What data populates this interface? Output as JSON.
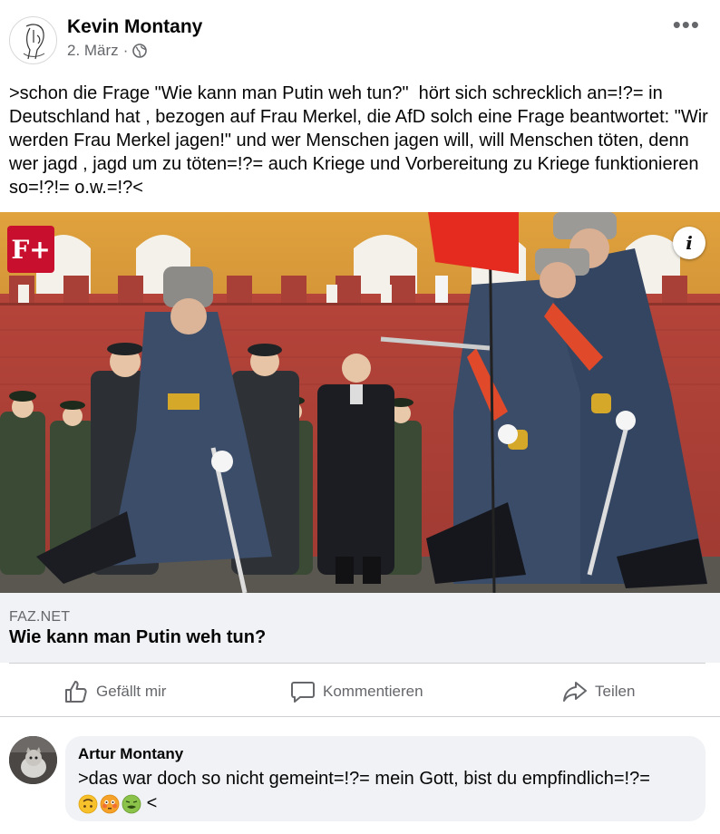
{
  "post": {
    "author": "Kevin Montany",
    "date": "2. März",
    "separator": "·",
    "more_label": "•••",
    "text": ">schon die Frage \"Wie kann man Putin weh tun?\"  hört sich schrecklich an=!?= in Deutschland hat , bezogen auf Frau Merkel, die AfD solch eine Frage beantwortet: \"Wir werden Frau Merkel jagen!\" und wer Menschen jagen will, will Menschen töten, denn wer jagd , jagd um zu töten=!?= auch Kriege und Vorbereitung zu Kriege funktionieren so=!?!= o.w.=!?<"
  },
  "link_card": {
    "badge": "F+",
    "info_icon_label": "i",
    "source": "FAZ.NET",
    "headline": "Wie kann man Putin weh tun?"
  },
  "actions": {
    "like": "Gefällt mir",
    "comment": "Kommentieren",
    "share": "Teilen"
  },
  "comment": {
    "author": "Artur Montany",
    "text": ">das war doch so nicht gemeint=!?= mein Gott, bist du empfindlich=!?=",
    "emojis": [
      "upside-down-face",
      "flushed-face",
      "nauseated-face"
    ],
    "trailing": "<"
  },
  "colors": {
    "text_primary": "#050505",
    "text_secondary": "#65676b",
    "card_background": "#f0f2f5",
    "faz_red": "#c8102e"
  },
  "icons": [
    "globe-icon",
    "more-options-icon",
    "thumbs-up-icon",
    "comment-icon",
    "share-arrow-icon",
    "info-icon"
  ]
}
